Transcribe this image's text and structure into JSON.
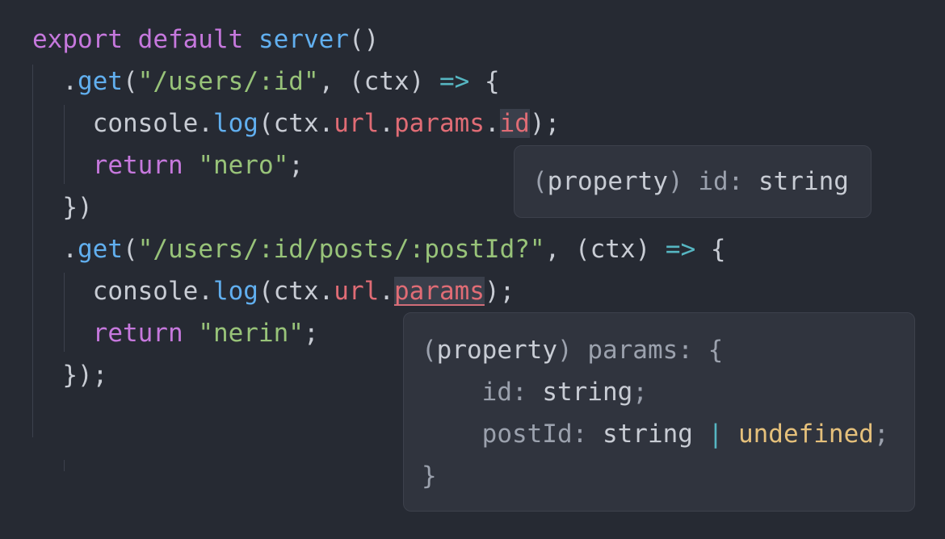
{
  "colors": {
    "background": "#262a33",
    "keyword": "#c678dd",
    "function": "#61afef",
    "string": "#98c379",
    "property": "#e06c75",
    "operator": "#56b6c2",
    "text": "#c8ccd4",
    "muted": "#9ba1ad",
    "type_undefined": "#e5c07b",
    "tooltip_bg": "#30343e"
  },
  "code": {
    "lines": [
      [
        {
          "t": "export",
          "c": "keyword"
        },
        {
          "t": " ",
          "c": "text"
        },
        {
          "t": "default",
          "c": "keyword"
        },
        {
          "t": " ",
          "c": "text"
        },
        {
          "t": "server",
          "c": "function"
        },
        {
          "t": "()",
          "c": "text"
        }
      ],
      [
        {
          "t": "  .",
          "c": "text"
        },
        {
          "t": "get",
          "c": "function"
        },
        {
          "t": "(",
          "c": "text"
        },
        {
          "t": "\"/users/:id\"",
          "c": "string"
        },
        {
          "t": ", (ctx) ",
          "c": "text"
        },
        {
          "t": "=>",
          "c": "operator"
        },
        {
          "t": " {",
          "c": "text"
        }
      ],
      [
        {
          "t": "    console.",
          "c": "text"
        },
        {
          "t": "log",
          "c": "function"
        },
        {
          "t": "(ctx.",
          "c": "text"
        },
        {
          "t": "url",
          "c": "property"
        },
        {
          "t": ".",
          "c": "text"
        },
        {
          "t": "params",
          "c": "property"
        },
        {
          "t": ".",
          "c": "text"
        },
        {
          "t": "id",
          "c": "property",
          "hl": true
        },
        {
          "t": ");",
          "c": "text"
        }
      ],
      [
        {
          "t": "    ",
          "c": "text"
        },
        {
          "t": "return",
          "c": "keyword"
        },
        {
          "t": " ",
          "c": "text"
        },
        {
          "t": "\"nero\"",
          "c": "string"
        },
        {
          "t": ";",
          "c": "text"
        }
      ],
      [
        {
          "t": "  })",
          "c": "text"
        }
      ],
      [
        {
          "t": "  .",
          "c": "text"
        },
        {
          "t": "get",
          "c": "function"
        },
        {
          "t": "(",
          "c": "text"
        },
        {
          "t": "\"/users/:id/posts/:postId?\"",
          "c": "string"
        },
        {
          "t": ", (ctx) ",
          "c": "text"
        },
        {
          "t": "=>",
          "c": "operator"
        },
        {
          "t": " {",
          "c": "text"
        }
      ],
      [
        {
          "t": "    console.",
          "c": "text"
        },
        {
          "t": "log",
          "c": "function"
        },
        {
          "t": "(ctx.",
          "c": "text"
        },
        {
          "t": "url",
          "c": "property"
        },
        {
          "t": ".",
          "c": "text"
        },
        {
          "t": "params",
          "c": "property",
          "hl": true,
          "sq": true
        },
        {
          "t": ");",
          "c": "text"
        }
      ],
      [
        {
          "t": "    ",
          "c": "text"
        },
        {
          "t": "return",
          "c": "keyword"
        },
        {
          "t": " ",
          "c": "text"
        },
        {
          "t": "\"nerin\"",
          "c": "string"
        },
        {
          "t": ";",
          "c": "text"
        }
      ],
      [
        {
          "t": "  });",
          "c": "text"
        }
      ]
    ]
  },
  "tooltips": [
    {
      "lines": [
        [
          {
            "t": "(",
            "c": "muted"
          },
          {
            "t": "property",
            "c": "text"
          },
          {
            "t": ") ",
            "c": "muted"
          },
          {
            "t": "id",
            "c": "muted"
          },
          {
            "t": ": ",
            "c": "muted"
          },
          {
            "t": "string",
            "c": "text"
          }
        ]
      ]
    },
    {
      "lines": [
        [
          {
            "t": "(",
            "c": "muted"
          },
          {
            "t": "property",
            "c": "text"
          },
          {
            "t": ") ",
            "c": "muted"
          },
          {
            "t": "params",
            "c": "muted"
          },
          {
            "t": ": {",
            "c": "muted"
          }
        ],
        [
          {
            "t": "    ",
            "c": "text"
          },
          {
            "t": "id",
            "c": "muted"
          },
          {
            "t": ": ",
            "c": "muted"
          },
          {
            "t": "string",
            "c": "text"
          },
          {
            "t": ";",
            "c": "muted"
          }
        ],
        [
          {
            "t": "    ",
            "c": "text"
          },
          {
            "t": "postId",
            "c": "muted"
          },
          {
            "t": ": ",
            "c": "muted"
          },
          {
            "t": "string",
            "c": "text"
          },
          {
            "t": " | ",
            "c": "operator"
          },
          {
            "t": "undefined",
            "c": "type_undefined"
          },
          {
            "t": ";",
            "c": "muted"
          }
        ],
        [
          {
            "t": "}",
            "c": "muted"
          }
        ]
      ]
    }
  ]
}
